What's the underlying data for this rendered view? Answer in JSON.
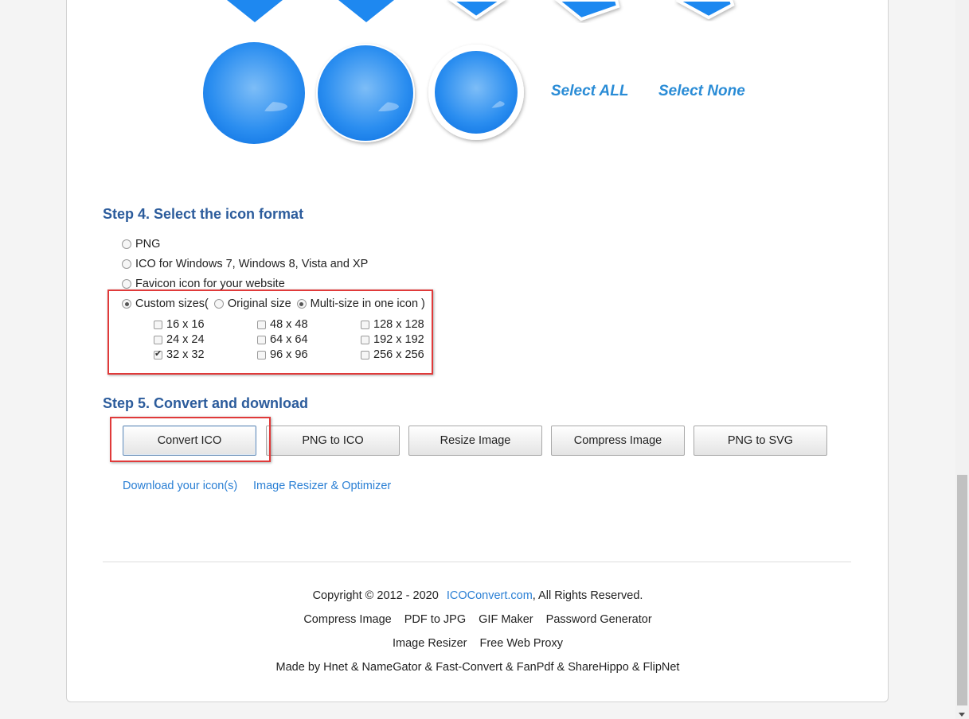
{
  "select_links": {
    "select_all": "Select ALL",
    "select_none": "Select None"
  },
  "step4": {
    "title": "Step 4. Select the icon format",
    "options": [
      {
        "label": "PNG",
        "selected": false
      },
      {
        "label": "ICO for Windows 7, Windows 8, Vista and XP",
        "selected": false
      },
      {
        "label": "Favicon icon for your website",
        "selected": false
      }
    ],
    "custom": {
      "label": "Custom sizes(",
      "selected": true,
      "original_size": {
        "label": "Original size",
        "selected": false
      },
      "multi_size": {
        "label": "Multi-size in one icon )",
        "selected": true
      }
    },
    "sizes": [
      {
        "label": "16 x 16",
        "checked": false
      },
      {
        "label": "24 x 24",
        "checked": false
      },
      {
        "label": "32 x 32",
        "checked": true
      },
      {
        "label": "48 x 48",
        "checked": false
      },
      {
        "label": "64 x 64",
        "checked": false
      },
      {
        "label": "96 x 96",
        "checked": false
      },
      {
        "label": "128 x 128",
        "checked": false
      },
      {
        "label": "192 x 192",
        "checked": false
      },
      {
        "label": "256 x 256",
        "checked": false
      }
    ]
  },
  "step5": {
    "title": "Step 5. Convert and download",
    "buttons": [
      "Convert ICO",
      "PNG to ICO",
      "Resize Image",
      "Compress Image",
      "PNG to SVG"
    ],
    "links": [
      "Download your icon(s)",
      "Image Resizer & Optimizer"
    ]
  },
  "footer": {
    "copyright_prefix": "Copyright © 2012 - 2020",
    "site": "ICOConvert.com",
    "rights": ", All Rights Reserved.",
    "links_row1": [
      "Compress Image",
      "PDF to JPG",
      "GIF Maker",
      "Password Generator"
    ],
    "links_row2": [
      "Image Resizer",
      "Free Web Proxy"
    ],
    "made_by": "Made by Hnet & NameGator & Fast-Convert & FanPdf & ShareHippo & FlipNet"
  },
  "colors": {
    "accent": "#2a8cd6",
    "heading": "#2c5c9c",
    "link": "#2a7fd4",
    "highlight": "#e03a3a",
    "icon_blue": "#1e88f0"
  }
}
